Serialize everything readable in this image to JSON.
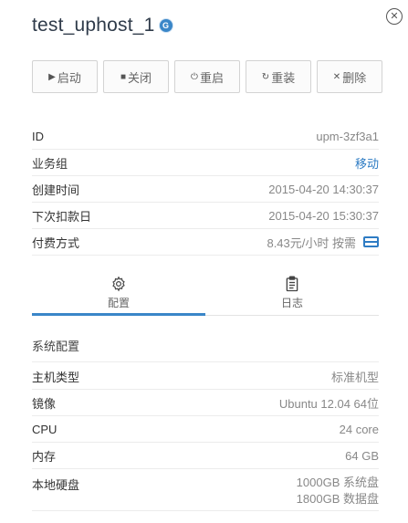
{
  "header": {
    "title": "test_uphost_1",
    "badge_glyph": "G",
    "close_glyph": "✕"
  },
  "toolbar": {
    "buttons": [
      {
        "icon": "play-icon",
        "glyph": "▶",
        "label": "启动"
      },
      {
        "icon": "stop-icon",
        "glyph": "■",
        "label": "关闭"
      },
      {
        "icon": "power-icon",
        "glyph": "⏻",
        "label": "重启"
      },
      {
        "icon": "reinstall-icon",
        "glyph": "↻",
        "label": "重装"
      },
      {
        "icon": "close-icon",
        "glyph": "✕",
        "label": "删除"
      }
    ]
  },
  "info": {
    "id": {
      "label": "ID",
      "value": "upm-3zf3a1"
    },
    "group": {
      "label": "业务组",
      "value": "移动"
    },
    "created": {
      "label": "创建时间",
      "value": "2015-04-20 14:30:37"
    },
    "next_charge": {
      "label": "下次扣款日",
      "value": "2015-04-20 15:30:37"
    },
    "billing": {
      "label": "付费方式",
      "value": "8.43元/小时 按需"
    }
  },
  "tabs": [
    {
      "label": "配置",
      "icon": "gear-icon",
      "active": true
    },
    {
      "label": "日志",
      "icon": "clipboard-icon",
      "active": false
    }
  ],
  "system_config": {
    "title": "系统配置",
    "rows": {
      "host_type": {
        "label": "主机类型",
        "value": "标准机型"
      },
      "image": {
        "label": "镜像",
        "value": "Ubuntu 12.04 64位"
      },
      "cpu": {
        "label": "CPU",
        "value": "24 core"
      },
      "memory": {
        "label": "内存",
        "value": "64 GB"
      },
      "disk": {
        "label": "本地硬盘",
        "system_disk": "1000GB 系统盘",
        "data_disk": "1800GB 数据盘"
      }
    }
  },
  "colors": {
    "accent": "#3a86c8",
    "link": "#2e7cc4"
  }
}
